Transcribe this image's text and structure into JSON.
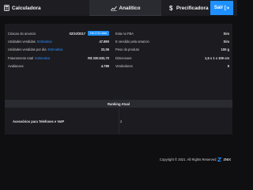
{
  "nav": {
    "calculadora": "Calculadora",
    "analitico": "Analítico",
    "precificadora": "Precificadora",
    "sair": "Sair"
  },
  "stats_left": [
    {
      "label": "Criacao do anuncio",
      "link": "",
      "value": "02/10/2017",
      "badge": "Há 1711 dias"
    },
    {
      "label": "Unidades vendidas",
      "link": "Estimativa",
      "value": "47.890",
      "badge": ""
    },
    {
      "label": "Unidades vendidas por dia",
      "link": "Estimativa",
      "value": "22,06",
      "badge": ""
    },
    {
      "label": "Faturamento total",
      "link": "Estimativa",
      "value": "R$ 330.532,70",
      "badge": ""
    },
    {
      "label": "Avaliacoes",
      "link": "",
      "value": "4.789",
      "badge": ""
    }
  ],
  "stats_right": [
    {
      "label": "Esta no FBA",
      "value": "Sim"
    },
    {
      "label": "E vendido pela amazon",
      "value": "Sim"
    },
    {
      "label": "Peso do produto",
      "value": "100 g"
    },
    {
      "label": "Dimensoes",
      "value": "1,5 x 1 x 109 cm"
    },
    {
      "label": "Vendedores",
      "value": "9"
    }
  ],
  "ranking": {
    "title": "Ranking Atual",
    "category": "Acessórios para Telefones e VoIP",
    "position": "2"
  },
  "footer": {
    "copyright": "Copyright © 2021. All Rights Reserved",
    "brand": "ZNIX"
  },
  "colors": {
    "accent": "#1e90ff",
    "background": "#0f0f12",
    "panel": "#1b1b20"
  }
}
